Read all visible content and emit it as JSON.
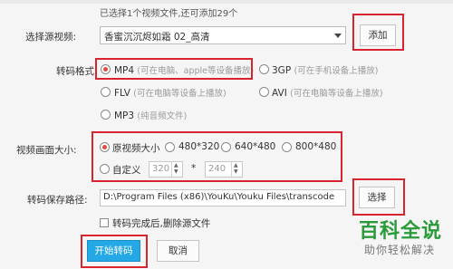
{
  "status_hint": "已选择1个视频文件,还可添加29个",
  "source": {
    "label": "选择源视频:",
    "selected": "香蜜沉沉烬如霜 02_高清",
    "add_button": "添加"
  },
  "format": {
    "label": "转码格式:",
    "options": [
      {
        "name": "MP4",
        "desc": "(可在电脑、apple等设备播放)",
        "selected": true
      },
      {
        "name": "3GP",
        "desc": "(可在手机设备上播放)",
        "selected": false
      },
      {
        "name": "FLV",
        "desc": "(可在电脑等设备上播放)",
        "selected": false
      },
      {
        "name": "AVI",
        "desc": "(可在电脑等设备上播放)",
        "selected": false
      },
      {
        "name": "MP3",
        "desc": "(纯音频文件)",
        "selected": false
      }
    ]
  },
  "size": {
    "label": "视频画面大小:",
    "options": [
      {
        "name": "原视频大小",
        "selected": true
      },
      {
        "name": "480*320",
        "selected": false
      },
      {
        "name": "640*480",
        "selected": false
      },
      {
        "name": "800*480",
        "selected": false
      }
    ],
    "custom_label": "自定义",
    "custom_width": "320",
    "separator": "*",
    "custom_height": "240"
  },
  "save": {
    "label": "转码保存路径:",
    "path": "D:\\Program Files (x86)\\YouKu\\Youku Files\\transcode",
    "choose_button": "选择"
  },
  "delete_source": {
    "label": "转码完成后,删除源文件",
    "checked": false
  },
  "actions": {
    "start": "开始转码",
    "cancel": "取消"
  },
  "watermark": {
    "title": "百科全说",
    "subtitle": "助你轻松解决"
  },
  "colors": {
    "highlight_box": "#d9232e",
    "primary_button": "#25a8e6",
    "radio_selected": "#e14c3c",
    "watermark_green": "#2a9b3a"
  }
}
